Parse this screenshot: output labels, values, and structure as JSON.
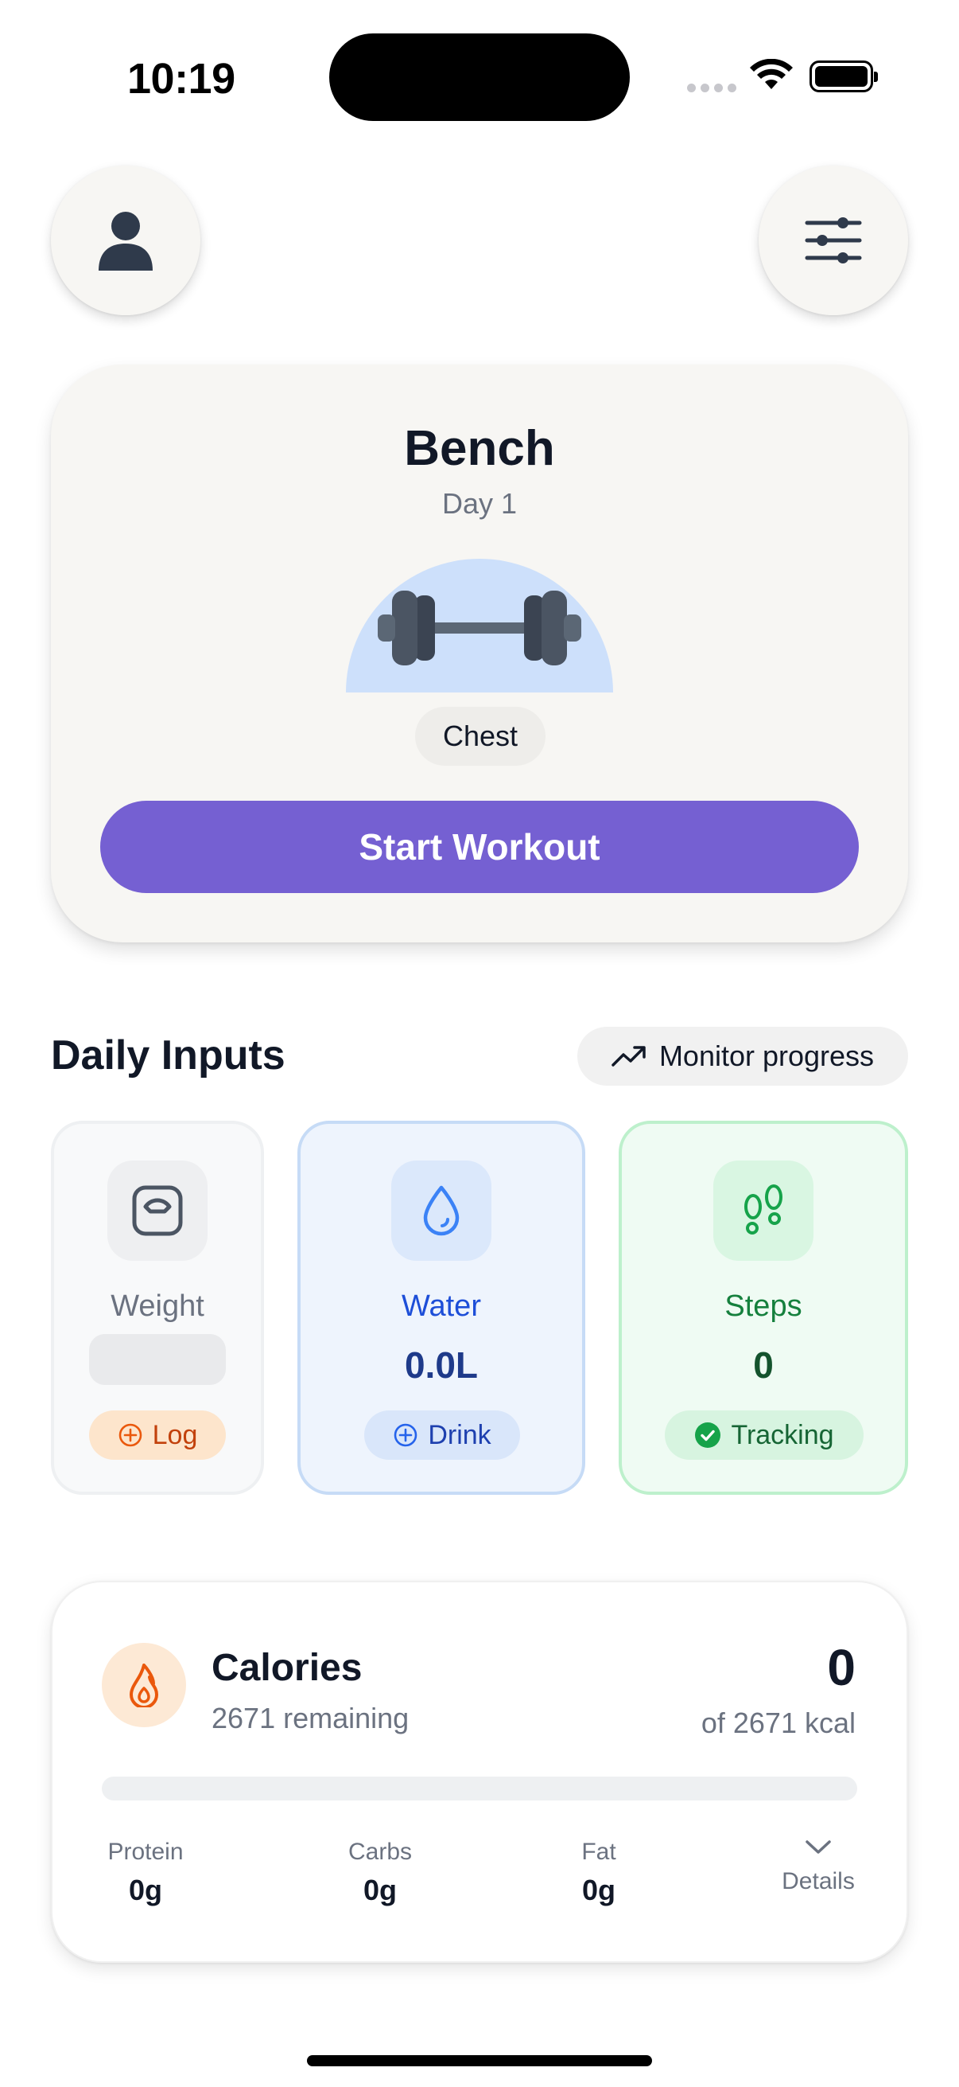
{
  "status_bar": {
    "time": "10:19"
  },
  "header": {
    "profile_icon": "person-icon",
    "filter_icon": "sliders-icon"
  },
  "workout": {
    "title": "Bench",
    "subtitle": "Day 1",
    "illustration": "dumbbell-icon",
    "muscle_group": "Chest",
    "start_label": "Start Workout",
    "accent": "#7560d2"
  },
  "daily_inputs": {
    "title": "Daily Inputs",
    "monitor_label": "Monitor progress",
    "monitor_icon": "trending-up-icon",
    "tiles": [
      {
        "label": "Weight",
        "value": "",
        "action": "Log",
        "icon": "scale-icon",
        "color": "#6b7280",
        "action_color": "#c2410c"
      },
      {
        "label": "Water",
        "value": "0.0L",
        "action": "Drink",
        "icon": "droplet-icon",
        "color": "#1d4ed8",
        "value_color": "#1e3a8a"
      },
      {
        "label": "Steps",
        "value": "0",
        "action": "Tracking",
        "icon": "footsteps-icon",
        "color": "#15803d",
        "value_color": "#14532d"
      }
    ]
  },
  "calories": {
    "title": "Calories",
    "remaining": "2671 remaining",
    "consumed": "0",
    "goal": "of 2671 kcal",
    "progress": 0,
    "macros": [
      {
        "label": "Protein",
        "value": "0g"
      },
      {
        "label": "Carbs",
        "value": "0g"
      },
      {
        "label": "Fat",
        "value": "0g"
      }
    ],
    "details_label": "Details"
  }
}
